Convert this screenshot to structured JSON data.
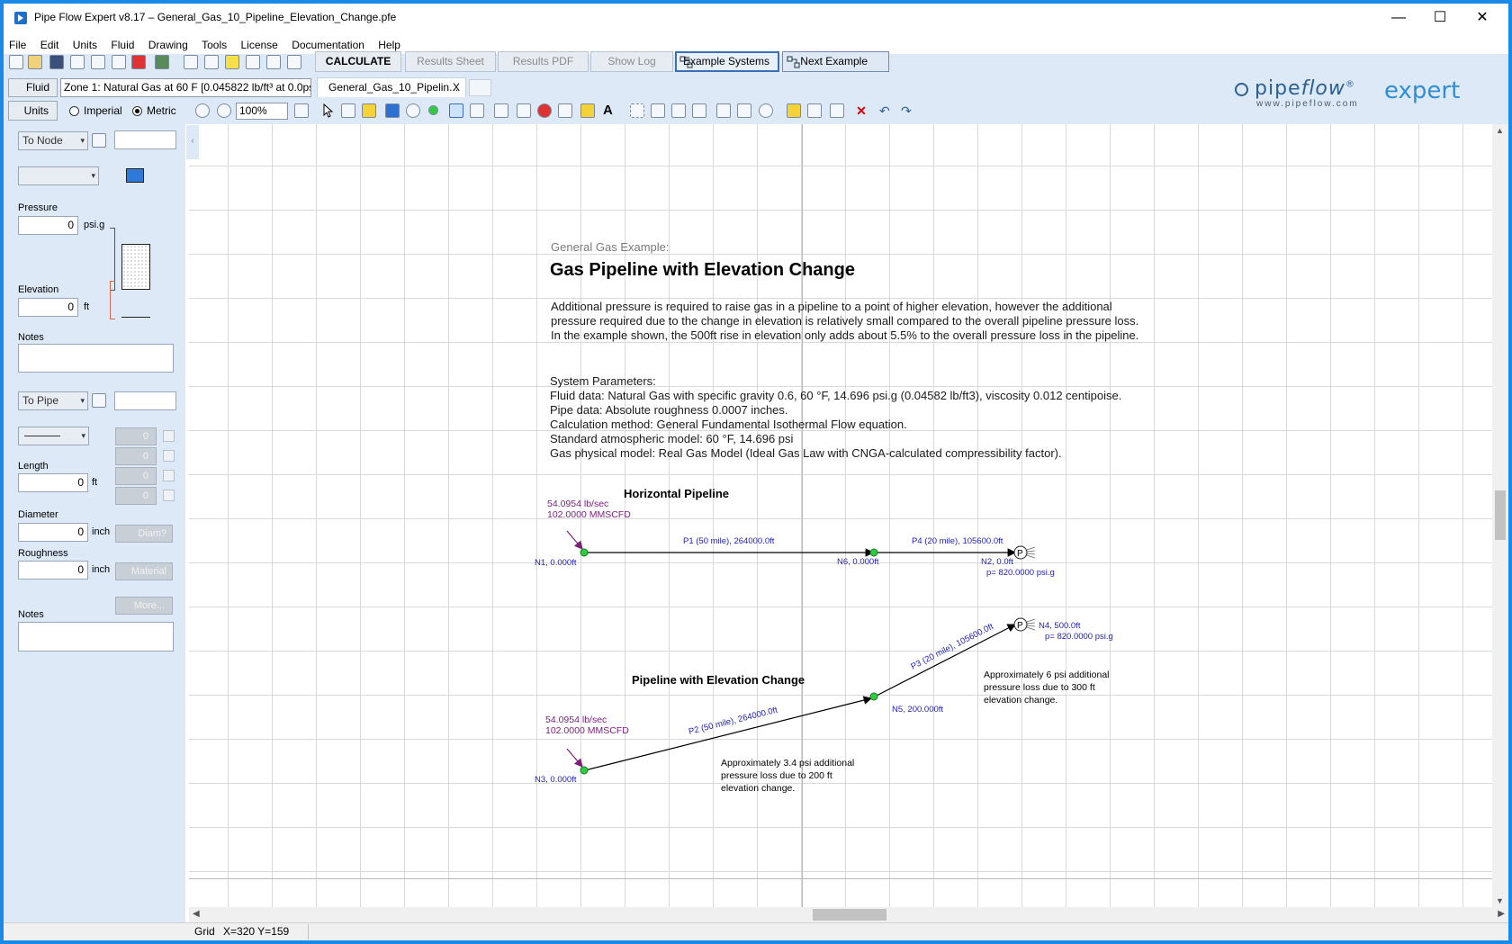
{
  "window": {
    "title": "Pipe Flow Expert v8.17 – General_Gas_10_Pipeline_Elevation_Change.pfe",
    "minimize": "—",
    "maximize": "☐",
    "close": "✕"
  },
  "menu": [
    "File",
    "Edit",
    "Units",
    "Fluid",
    "Drawing",
    "Tools",
    "License",
    "Documentation",
    "Help"
  ],
  "toolbar": {
    "calculate": "CALCULATE",
    "results_sheet": "Results Sheet",
    "results_pdf": "Results PDF",
    "show_log": "Show Log",
    "example_systems": "Example Systems",
    "next_example": "Next Example",
    "fluid": "Fluid",
    "zone": "Zone 1: Natural Gas at 60 F [0.045822 lb/ft³ at 0.0psi",
    "doc_tab": "General_Gas_10_Pipelin...",
    "doc_tab_close": "X",
    "units": "Units",
    "imperial": "Imperial",
    "metric": "Metric",
    "selected_units": "Metric",
    "zoom": "100%"
  },
  "logo": {
    "pipe": "pipe",
    "flow": "flow",
    "reg": "®",
    "expert": "expert",
    "url": "www.pipeflow.com"
  },
  "left_panel": {
    "node_select": "To Node",
    "node_id": "",
    "fluid_select": "",
    "pressure_label": "Pressure",
    "pressure_value": "0",
    "pressure_unit": "psi.g",
    "elevation_label": "Elevation",
    "elevation_value": "0",
    "elevation_unit": "ft",
    "notes_label": "Notes",
    "notes_value": "",
    "pipe_select": "To Pipe",
    "pipe_id": "",
    "fitting_counts": [
      "0",
      "0",
      "0",
      "0"
    ],
    "length_label": "Length",
    "length_value": "0",
    "length_unit": "ft",
    "diameter_label": "Diameter",
    "diameter_value": "0",
    "diameter_unit": "inch",
    "diam_btn": "Diam?",
    "roughness_label": "Roughness",
    "roughness_value": "0",
    "roughness_unit": "inch",
    "material_btn": "Material",
    "more_btn": "More...",
    "pipe_notes_label": "Notes",
    "pipe_notes_value": ""
  },
  "document": {
    "subtitle": "General Gas Example:",
    "title": "Gas Pipeline with Elevation Change",
    "intro": [
      "Additional pressure is required to raise gas in a pipeline to a point of higher elevation, however the additional",
      "pressure required due to the change in elevation is relatively small compared to the overall pipeline pressure loss.",
      "In the example shown, the 500ft rise in elevation only adds about 5.5% to the overall pressure loss in the pipeline."
    ],
    "params": [
      "System Parameters:",
      "Fluid data: Natural Gas with specific gravity 0.6, 60 °F, 14.696 psi.g (0.04582 lb/ft3), viscosity 0.012 centipoise.",
      "Pipe data: Absolute roughness 0.0007 inches.",
      "Calculation method: General Fundamental Isothermal Flow equation.",
      "Standard atmospheric model: 60 °F, 14.696 psi",
      "Gas physical model: Real Gas Model (Ideal Gas Law with CNGA-calculated compressibility factor)."
    ]
  },
  "diagram": {
    "horizontal_title": "Horizontal Pipeline",
    "elevation_title": "Pipeline with Elevation Change",
    "flow_in_top_1": "54.0954 lb/sec",
    "flow_in_top_2": "102.0000 MMSCFD",
    "flow_in_bot_1": "54.0954 lb/sec",
    "flow_in_bot_2": "102.0000 MMSCFD",
    "n1": "N1, 0.000ft",
    "n6": "N6, 0.000ft",
    "n2": "N2, 0.0ft",
    "n2_p": "p= 820.0000 psi.g",
    "n3": "N3, 0.000ft",
    "n5": "N5, 200.000ft",
    "n4": "N4, 500.0ft",
    "n4_p": "p= 820.0000 psi.g",
    "p1": "P1 (50 mile), 264000.0ft",
    "p4": "P4 (20 mile), 105600.0ft",
    "p2": "P2 (50 mile), 264000.0ft",
    "p3": "P3 (20 mile), 105600.0ft",
    "pressure_symbol": "P",
    "note_bottom": [
      "Approximately 3.4 psi additional",
      "pressure loss due to 200 ft",
      "elevation change."
    ],
    "note_right": [
      "Approximately 6 psi additional",
      "pressure loss due to 300 ft",
      "elevation change."
    ]
  },
  "status": {
    "grid": "Grid",
    "coords": "X=320  Y=159"
  },
  "colors": {
    "accent": "#1a89e8",
    "panel_bg": "#dde9f7",
    "diagram_label": "#1f1fb4",
    "flow_label": "#7a1f7a",
    "node_fill": "#2ecc40"
  }
}
